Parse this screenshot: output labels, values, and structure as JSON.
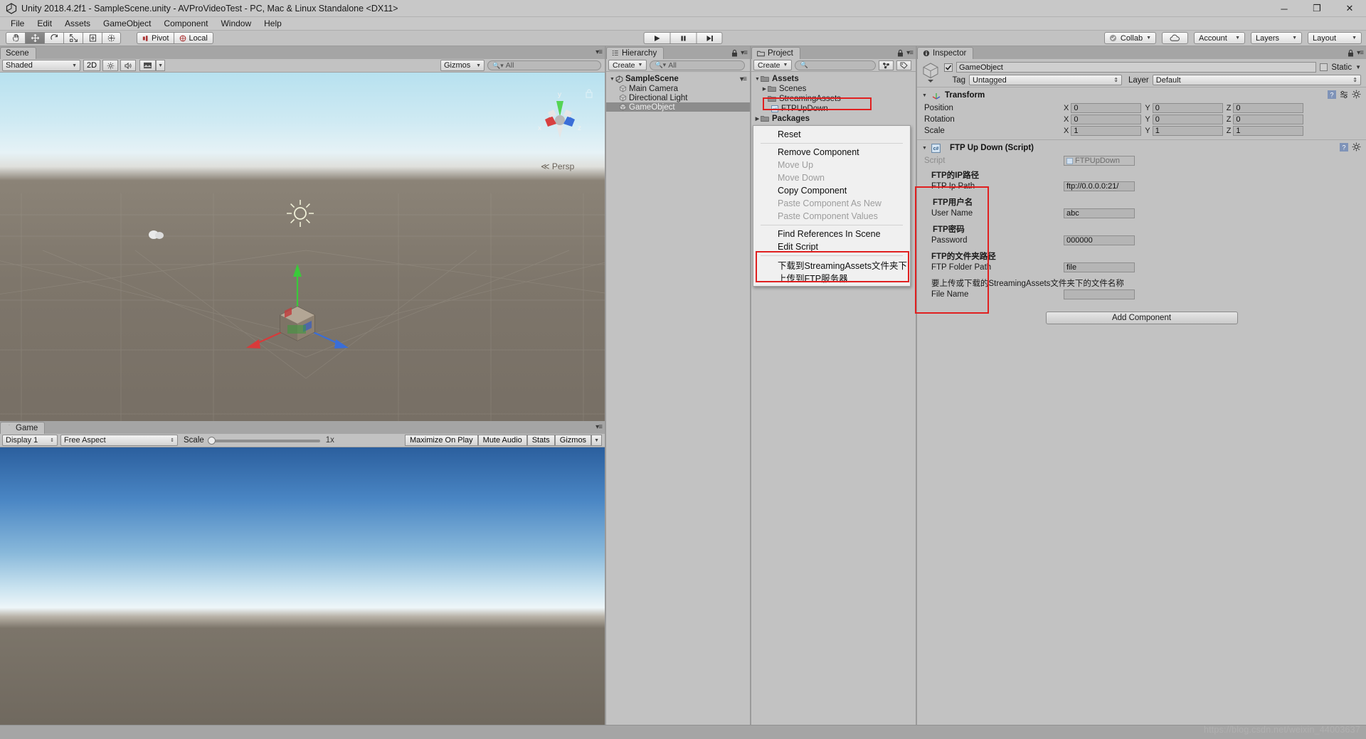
{
  "window": {
    "title": "Unity 2018.4.2f1 - SampleScene.unity - AVProVideoTest - PC, Mac & Linux Standalone <DX11>",
    "minimize": "─",
    "maximize": "❐",
    "close": "✕"
  },
  "menubar": {
    "items": [
      "File",
      "Edit",
      "Assets",
      "GameObject",
      "Component",
      "Window",
      "Help"
    ]
  },
  "toolbar": {
    "tools": [
      "hand-tool",
      "move-tool",
      "rotate-tool",
      "scale-tool",
      "rect-tool",
      "transform-tool"
    ],
    "selected_tool_index": 1,
    "pivot_label": "Pivot",
    "local_label": "Local",
    "play_label": "▶",
    "pause_label": "❚❚",
    "step_label": "▶❚",
    "collab_label": "Collab",
    "cloud_label": "cloud-icon",
    "account_label": "Account",
    "layers_label": "Layers",
    "layout_label": "Layout"
  },
  "scene_panel": {
    "tab": "Scene",
    "shading_mode": "Shaded",
    "mode_2d": "2D",
    "lighting_icon": "sun-icon",
    "audio_icon": "speaker-icon",
    "fx_icon": "image-icon",
    "gizmos_label": "Gizmos",
    "search_placeholder": "All",
    "persp_label": "Persp",
    "axis_x": "x",
    "axis_y": "y",
    "axis_z": "z"
  },
  "game_panel": {
    "tab": "Game",
    "display": "Display 1",
    "aspect": "Free Aspect",
    "scale_label": "Scale",
    "scale_value": "1x",
    "maximize_on_play": "Maximize On Play",
    "mute_audio": "Mute Audio",
    "stats": "Stats",
    "gizmos": "Gizmos"
  },
  "hierarchy_panel": {
    "tab": "Hierarchy",
    "create_label": "Create",
    "search_placeholder": "All",
    "scene_name": "SampleScene",
    "items": [
      {
        "label": "Main Camera",
        "selected": false
      },
      {
        "label": "Directional Light",
        "selected": false
      },
      {
        "label": "GameObject",
        "selected": true
      }
    ]
  },
  "project_panel": {
    "tab": "Project",
    "create_label": "Create",
    "search_placeholder": "",
    "tree": [
      {
        "label": "Assets",
        "depth": 0,
        "type": "folder",
        "expanded": true,
        "bold": true,
        "highlighted": false
      },
      {
        "label": "Scenes",
        "depth": 1,
        "type": "folder",
        "expanded": false,
        "bold": false,
        "highlighted": false
      },
      {
        "label": "StreamingAssets",
        "depth": 1,
        "type": "folder",
        "expanded": null,
        "bold": false,
        "highlighted": true
      },
      {
        "label": "FTPUpDown",
        "depth": 2,
        "type": "script",
        "expanded": null,
        "bold": false,
        "highlighted": false
      },
      {
        "label": "Packages",
        "depth": 0,
        "type": "folder",
        "expanded": false,
        "bold": true,
        "highlighted": false
      }
    ]
  },
  "inspector": {
    "tab": "Inspector",
    "object_name": "GameObject",
    "enabled": true,
    "static_label": "Static",
    "tag_label": "Tag",
    "tag_value": "Untagged",
    "layer_label": "Layer",
    "layer_value": "Default",
    "transform": {
      "title": "Transform",
      "rows": [
        {
          "label": "Position",
          "x": "0",
          "y": "0",
          "z": "0"
        },
        {
          "label": "Rotation",
          "x": "0",
          "y": "0",
          "z": "0"
        },
        {
          "label": "Scale",
          "x": "1",
          "y": "1",
          "z": "1"
        }
      ],
      "axis_labels": [
        "X",
        "Y",
        "Z"
      ]
    },
    "script_component": {
      "title": "FTP Up Down (Script)",
      "script_row_label": "Script",
      "script_value": "FTPUpDown",
      "fields": [
        {
          "header": "FTP的IP路径",
          "label": "FTP Ip Path",
          "value": "ftp://0.0.0.0:21/"
        },
        {
          "header": "FTP用户名",
          "label": "User Name",
          "value": "abc"
        },
        {
          "header": "FTP密码",
          "label": "Password",
          "value": "000000"
        },
        {
          "header": "FTP的文件夹路径",
          "label": "FTP Folder Path",
          "value": "file"
        },
        {
          "header": "要上传或下载的StreamingAssets文件夹下的文件名称",
          "label": "File Name",
          "value": ""
        }
      ]
    },
    "add_component_label": "Add Component"
  },
  "context_menu": {
    "items": [
      {
        "label": "Reset",
        "disabled": false,
        "separator_after": true
      },
      {
        "label": "Remove Component",
        "disabled": false,
        "separator_after": false
      },
      {
        "label": "Move Up",
        "disabled": true,
        "separator_after": false
      },
      {
        "label": "Move Down",
        "disabled": true,
        "separator_after": false
      },
      {
        "label": "Copy Component",
        "disabled": false,
        "separator_after": false
      },
      {
        "label": "Paste Component As New",
        "disabled": true,
        "separator_after": false
      },
      {
        "label": "Paste Component Values",
        "disabled": true,
        "separator_after": true
      },
      {
        "label": "Find References In Scene",
        "disabled": false,
        "separator_after": false
      },
      {
        "label": "Edit Script",
        "disabled": false,
        "separator_after": true
      },
      {
        "label": "下载到StreamingAssets文件夹下",
        "disabled": false,
        "separator_after": false
      },
      {
        "label": "上传到FTP服务器",
        "disabled": false,
        "separator_after": false
      }
    ]
  },
  "watermark": "https://blog.csdn.net/weixin_44003637",
  "colors": {
    "highlight": "#e02020",
    "selection": "#8c8c8c",
    "panel": "#c2c2c2"
  }
}
